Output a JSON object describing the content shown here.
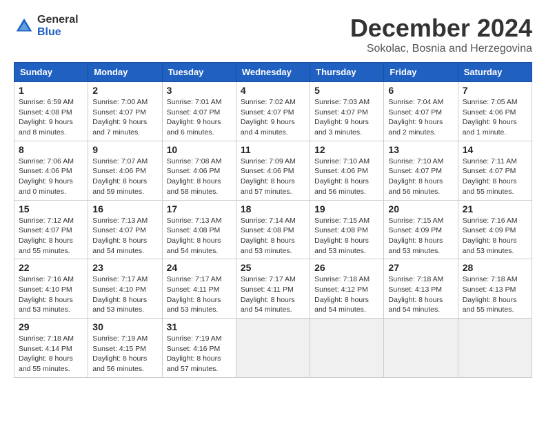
{
  "logo": {
    "general": "General",
    "blue": "Blue"
  },
  "title": "December 2024",
  "subtitle": "Sokolac, Bosnia and Herzegovina",
  "days_of_week": [
    "Sunday",
    "Monday",
    "Tuesday",
    "Wednesday",
    "Thursday",
    "Friday",
    "Saturday"
  ],
  "weeks": [
    [
      {
        "day": "1",
        "sunrise": "6:59 AM",
        "sunset": "4:08 PM",
        "daylight": "9 hours and 8 minutes."
      },
      {
        "day": "2",
        "sunrise": "7:00 AM",
        "sunset": "4:07 PM",
        "daylight": "9 hours and 7 minutes."
      },
      {
        "day": "3",
        "sunrise": "7:01 AM",
        "sunset": "4:07 PM",
        "daylight": "9 hours and 6 minutes."
      },
      {
        "day": "4",
        "sunrise": "7:02 AM",
        "sunset": "4:07 PM",
        "daylight": "9 hours and 4 minutes."
      },
      {
        "day": "5",
        "sunrise": "7:03 AM",
        "sunset": "4:07 PM",
        "daylight": "9 hours and 3 minutes."
      },
      {
        "day": "6",
        "sunrise": "7:04 AM",
        "sunset": "4:07 PM",
        "daylight": "9 hours and 2 minutes."
      },
      {
        "day": "7",
        "sunrise": "7:05 AM",
        "sunset": "4:06 PM",
        "daylight": "9 hours and 1 minute."
      }
    ],
    [
      {
        "day": "8",
        "sunrise": "7:06 AM",
        "sunset": "4:06 PM",
        "daylight": "9 hours and 0 minutes."
      },
      {
        "day": "9",
        "sunrise": "7:07 AM",
        "sunset": "4:06 PM",
        "daylight": "8 hours and 59 minutes."
      },
      {
        "day": "10",
        "sunrise": "7:08 AM",
        "sunset": "4:06 PM",
        "daylight": "8 hours and 58 minutes."
      },
      {
        "day": "11",
        "sunrise": "7:09 AM",
        "sunset": "4:06 PM",
        "daylight": "8 hours and 57 minutes."
      },
      {
        "day": "12",
        "sunrise": "7:10 AM",
        "sunset": "4:06 PM",
        "daylight": "8 hours and 56 minutes."
      },
      {
        "day": "13",
        "sunrise": "7:10 AM",
        "sunset": "4:07 PM",
        "daylight": "8 hours and 56 minutes."
      },
      {
        "day": "14",
        "sunrise": "7:11 AM",
        "sunset": "4:07 PM",
        "daylight": "8 hours and 55 minutes."
      }
    ],
    [
      {
        "day": "15",
        "sunrise": "7:12 AM",
        "sunset": "4:07 PM",
        "daylight": "8 hours and 55 minutes."
      },
      {
        "day": "16",
        "sunrise": "7:13 AM",
        "sunset": "4:07 PM",
        "daylight": "8 hours and 54 minutes."
      },
      {
        "day": "17",
        "sunrise": "7:13 AM",
        "sunset": "4:08 PM",
        "daylight": "8 hours and 54 minutes."
      },
      {
        "day": "18",
        "sunrise": "7:14 AM",
        "sunset": "4:08 PM",
        "daylight": "8 hours and 53 minutes."
      },
      {
        "day": "19",
        "sunrise": "7:15 AM",
        "sunset": "4:08 PM",
        "daylight": "8 hours and 53 minutes."
      },
      {
        "day": "20",
        "sunrise": "7:15 AM",
        "sunset": "4:09 PM",
        "daylight": "8 hours and 53 minutes."
      },
      {
        "day": "21",
        "sunrise": "7:16 AM",
        "sunset": "4:09 PM",
        "daylight": "8 hours and 53 minutes."
      }
    ],
    [
      {
        "day": "22",
        "sunrise": "7:16 AM",
        "sunset": "4:10 PM",
        "daylight": "8 hours and 53 minutes."
      },
      {
        "day": "23",
        "sunrise": "7:17 AM",
        "sunset": "4:10 PM",
        "daylight": "8 hours and 53 minutes."
      },
      {
        "day": "24",
        "sunrise": "7:17 AM",
        "sunset": "4:11 PM",
        "daylight": "8 hours and 53 minutes."
      },
      {
        "day": "25",
        "sunrise": "7:17 AM",
        "sunset": "4:11 PM",
        "daylight": "8 hours and 54 minutes."
      },
      {
        "day": "26",
        "sunrise": "7:18 AM",
        "sunset": "4:12 PM",
        "daylight": "8 hours and 54 minutes."
      },
      {
        "day": "27",
        "sunrise": "7:18 AM",
        "sunset": "4:13 PM",
        "daylight": "8 hours and 54 minutes."
      },
      {
        "day": "28",
        "sunrise": "7:18 AM",
        "sunset": "4:13 PM",
        "daylight": "8 hours and 55 minutes."
      }
    ],
    [
      {
        "day": "29",
        "sunrise": "7:18 AM",
        "sunset": "4:14 PM",
        "daylight": "8 hours and 55 minutes."
      },
      {
        "day": "30",
        "sunrise": "7:19 AM",
        "sunset": "4:15 PM",
        "daylight": "8 hours and 56 minutes."
      },
      {
        "day": "31",
        "sunrise": "7:19 AM",
        "sunset": "4:16 PM",
        "daylight": "8 hours and 57 minutes."
      },
      null,
      null,
      null,
      null
    ]
  ],
  "labels": {
    "sunrise": "Sunrise:",
    "sunset": "Sunset:",
    "daylight": "Daylight:"
  }
}
